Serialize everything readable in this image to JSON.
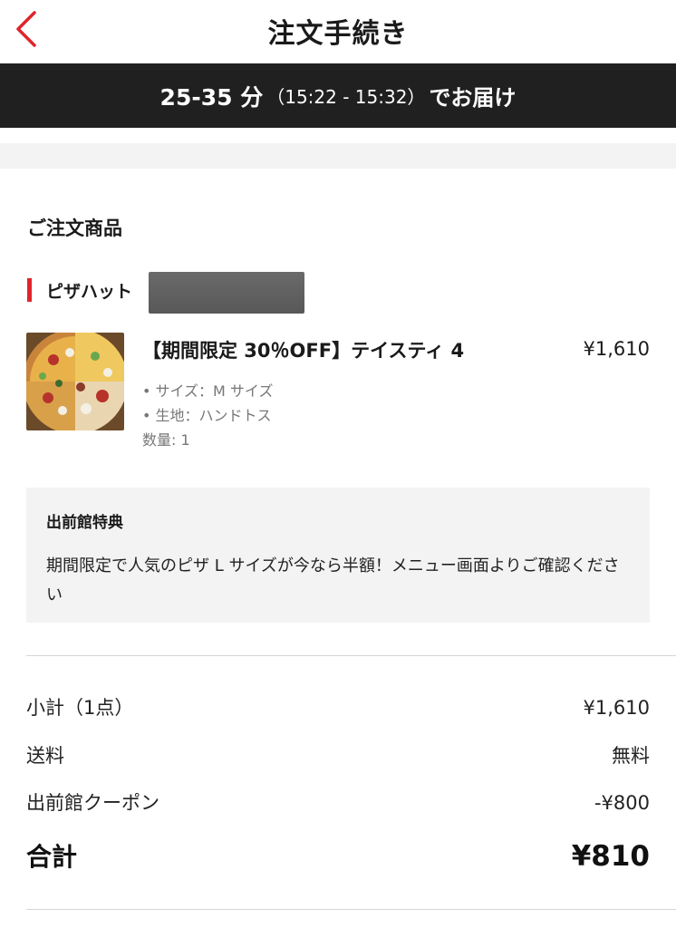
{
  "header": {
    "title": "注文手続き"
  },
  "eta": {
    "main": "25-35 分",
    "range": "（15:22 - 15:32）",
    "suffix": "でお届け"
  },
  "order": {
    "section_title": "ご注文商品",
    "store_name": "ピザハット",
    "item": {
      "name": "【期間限定 30％OFF】テイスティ 4",
      "price": "¥1,610",
      "options": [
        "• サイズ：M サイズ",
        "• 生地：ハンドトス"
      ],
      "quantity": "数量: 1"
    }
  },
  "promo": {
    "title": "出前館特典",
    "body": "期間限定で人気のピザ L サイズが今なら半額！メニュー画面よりご確認ください"
  },
  "summary": {
    "subtotal_label": "小計（1点）",
    "subtotal_value": "¥1,610",
    "shipping_label": "送料",
    "shipping_value": "無料",
    "coupon_label": "出前館クーポン",
    "coupon_value": "-¥800",
    "total_label": "合計",
    "total_value": "¥810"
  },
  "colors": {
    "accent": "#e0242a",
    "eta_bar": "#202020"
  }
}
